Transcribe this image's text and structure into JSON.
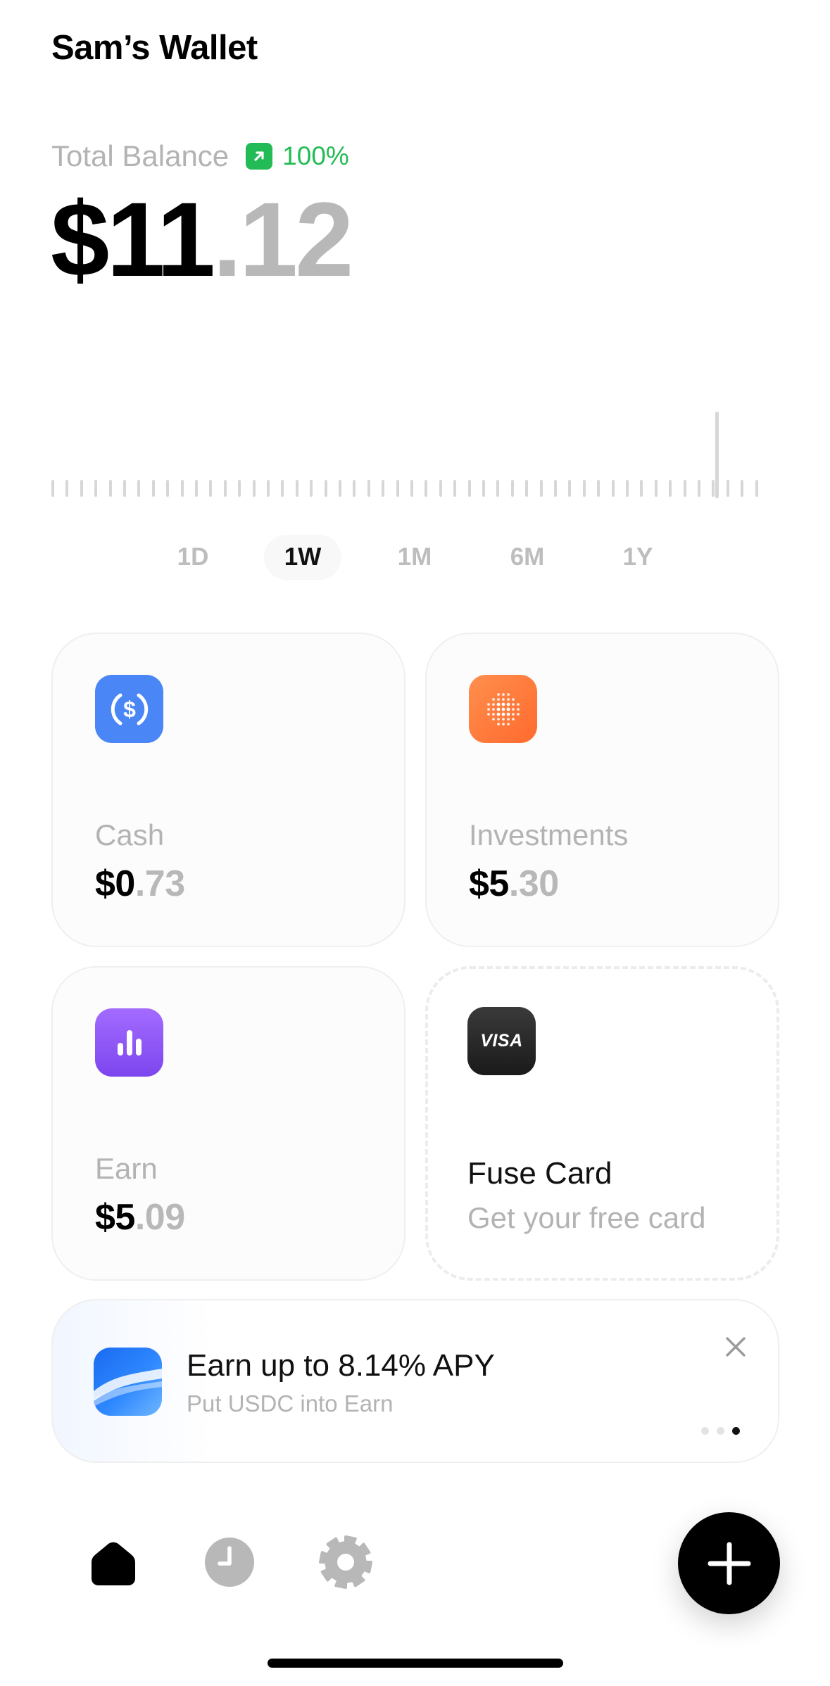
{
  "header": {
    "title": "Sam’s Wallet"
  },
  "balance": {
    "label": "Total Balance",
    "change": "100%",
    "change_icon": "arrow-up-right-icon",
    "whole": "$11",
    "fraction": ".12"
  },
  "chart_data": {
    "type": "bar",
    "description_values": "sparkline of balance over selected range; last point rises",
    "values": [
      0,
      0,
      0,
      0,
      0,
      0,
      0,
      0,
      0,
      0,
      0,
      0,
      0,
      0,
      0,
      0,
      0,
      0,
      0,
      0,
      0,
      0,
      0,
      0,
      0,
      0,
      0,
      0,
      0,
      0,
      0,
      0,
      0,
      0,
      0,
      0,
      0,
      0,
      0,
      0,
      0,
      0,
      0,
      0,
      0,
      0,
      0,
      0,
      0,
      0,
      11.12
    ]
  },
  "ranges": {
    "items": [
      "1D",
      "1W",
      "1M",
      "6M",
      "1Y"
    ],
    "selected": "1W"
  },
  "cards": {
    "cash": {
      "label": "Cash",
      "whole": "$0",
      "fraction": ".73",
      "icon": "usd-coin-icon",
      "color": "#4a86f5"
    },
    "investments": {
      "label": "Investments",
      "whole": "$5",
      "fraction": ".30",
      "icon": "dot-grid-icon",
      "color": "#ff7a3d"
    },
    "earn": {
      "label": "Earn",
      "whole": "$5",
      "fraction": ".09",
      "icon": "bar-chart-icon",
      "color": "#8b53f0"
    },
    "fuse_card": {
      "title": "Fuse Card",
      "subtitle": "Get your free card",
      "icon_text": "VISA"
    }
  },
  "promo": {
    "title": "Earn up to 8.14% APY",
    "subtitle": "Put USDC into Earn",
    "page_count": 3,
    "active_page": 3
  },
  "nav": {
    "items": [
      "home-icon",
      "clock-icon",
      "gear-icon"
    ],
    "fab_icon": "plus-icon"
  }
}
